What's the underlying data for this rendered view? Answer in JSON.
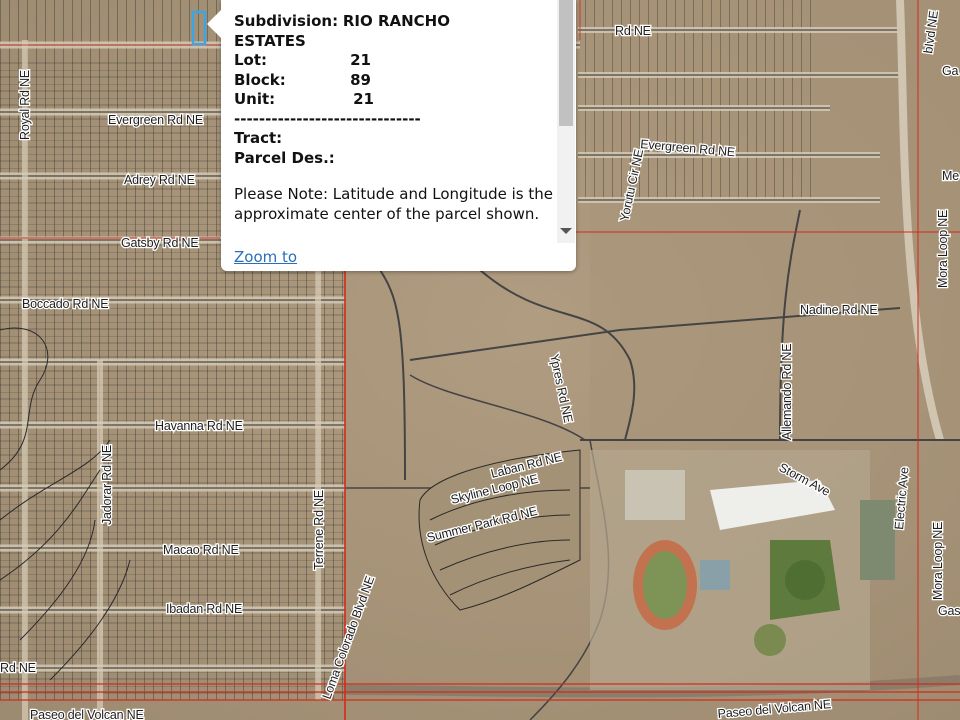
{
  "map": {
    "roads": [
      {
        "name": "Royal Rd NE"
      },
      {
        "name": "Evergreen Rd NE"
      },
      {
        "name": "Adrey Rd NE"
      },
      {
        "name": "Gatsby Rd NE"
      },
      {
        "name": "Boccado Rd NE"
      },
      {
        "name": "Havanna Rd NE"
      },
      {
        "name": "Jadorar Rd NE"
      },
      {
        "name": "Macao Rd NE"
      },
      {
        "name": "Ibadan Rd NE"
      },
      {
        "name": "Terrene Rd NE"
      },
      {
        "name": "Loma Colorado Blvd NE"
      },
      {
        "name": "Paseo del Volcan NE"
      },
      {
        "name": "Ypres Rd NE"
      },
      {
        "name": "Laban Rd NE"
      },
      {
        "name": "Skyline Loop NE"
      },
      {
        "name": "Summer Park Rd NE"
      },
      {
        "name": "Yorutu Cir NE"
      },
      {
        "name": "Evergreen Rd NE"
      },
      {
        "name": "Nadine Rd NE"
      },
      {
        "name": "Allemando Rd NE"
      },
      {
        "name": "Storm Ave"
      },
      {
        "name": "Electric Ave"
      },
      {
        "name": "Mora Loop NE"
      },
      {
        "name": "Mora Loop NE"
      },
      {
        "name": "Paseo del Volcan NE"
      },
      {
        "name": "bIvd NE"
      },
      {
        "name": "Rd NE"
      },
      {
        "name": "Rd NE"
      },
      {
        "name": "Me"
      },
      {
        "name": "Ga"
      },
      {
        "name": "Gas"
      }
    ],
    "colors": {
      "parcel_line": "#2a2a2a",
      "boundary_red": "#d42a1e",
      "highlight": "#3aa6e8"
    }
  },
  "popup": {
    "subdivision_label": "Subdivision:",
    "subdivision_value": "RIO RANCHO",
    "subdivision_value_cont": "ESTATES",
    "lot_label": "Lot:",
    "lot_value": "21",
    "block_label": "Block:",
    "block_value": "89",
    "unit_label": "Unit:",
    "unit_value": "21",
    "separator": "------------------------------",
    "tract_label": "Tract:",
    "parcel_label": "Parcel Des.:",
    "note": "Please Note: Latitude and Longitude is the approximate center of the parcel shown.",
    "zoom_link": "Zoom to"
  }
}
